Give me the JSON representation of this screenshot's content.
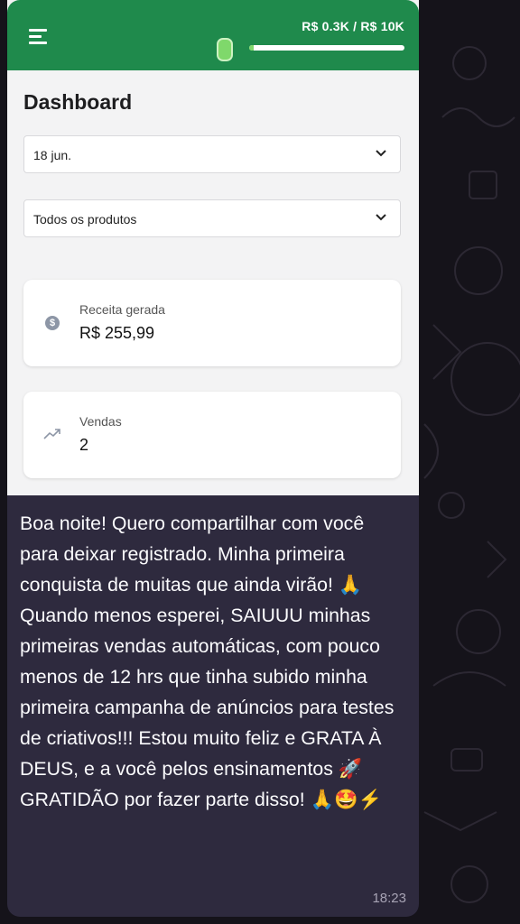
{
  "topbar": {
    "goal_text": "R$ 0.3K / R$ 10K",
    "goal_progress": 0.03,
    "accent_color": "#1f8a4c"
  },
  "dashboard": {
    "title": "Dashboard",
    "date_select": {
      "value": "18 jun."
    },
    "product_select": {
      "value": "Todos os produtos"
    },
    "revenue_card": {
      "label": "Receita gerada",
      "value": "R$ 255,99",
      "icon": "dollar-coin-icon"
    },
    "sales_card": {
      "label": "Vendas",
      "value": "2",
      "icon": "trending-up-icon"
    }
  },
  "chat": {
    "message": "Boa noite! Quero compartilhar com você para deixar registrado. Minha primeira conquista de muitas que ainda virão! 🙏\nQuando menos esperei, SAIUUU minhas primeiras vendas automáticas, com pouco menos de 12 hrs que tinha subido minha primeira campanha de anúncios para testes de criativos!!! Estou muito feliz e GRATA À DEUS, e a você pelos ensinamentos 🚀 GRATIDÃO por fazer parte disso! 🙏🤩⚡",
    "time": "18:23"
  }
}
